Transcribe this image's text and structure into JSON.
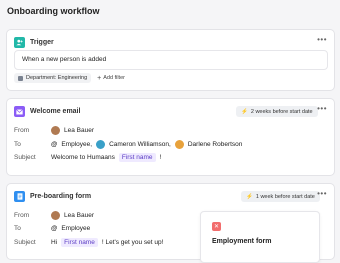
{
  "page": {
    "title": "Onboarding workflow"
  },
  "trigger": {
    "title": "Trigger",
    "condition": "When a new person is added",
    "filter_tag": "Department: Engineering",
    "add_filter": "Add filter",
    "more": "•••"
  },
  "welcome_email": {
    "title": "Welcome email",
    "timing": "2 weeks before start date",
    "more": "•••",
    "from_label": "From",
    "from_name": "Lea Bauer",
    "to_label": "To",
    "to_employee": "Employee,",
    "to_person1": "Cameron Williamson,",
    "to_person2": "Darlene Robertson",
    "subject_label": "Subject",
    "subject_text": "Welcome to Humaans",
    "subject_var": "First name",
    "subject_end": "!"
  },
  "preboarding": {
    "title": "Pre-boarding form",
    "timing": "1 week before start date",
    "more": "•••",
    "from_label": "From",
    "from_name": "Lea Bauer",
    "to_label": "To",
    "to_employee": "Employee",
    "subject_label": "Subject",
    "subject_text": "Hi",
    "subject_var": "First name",
    "subject_end": "! Let's get you set up!",
    "form_card_title": "Employment form"
  },
  "colors": {
    "trigger_icon": "#22b8a8",
    "email_icon": "#8b5cf6",
    "form_icon": "#2f8ff0",
    "form_badge": "#f26d6d"
  }
}
